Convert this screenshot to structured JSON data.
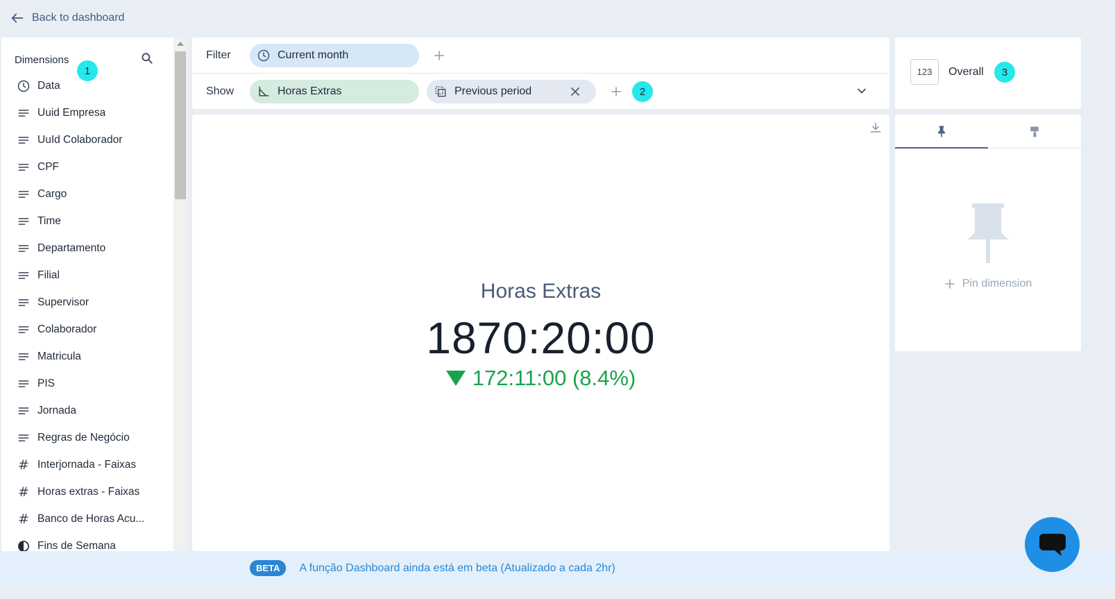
{
  "nav": {
    "back_label": "Back to dashboard"
  },
  "sidebar": {
    "title": "Dimensions",
    "badge": "1",
    "items": [
      {
        "label": "Data",
        "icon": "clock-icon"
      },
      {
        "label": "Uuid Empresa",
        "icon": "text-lines-icon"
      },
      {
        "label": "UuId Colaborador",
        "icon": "text-lines-icon"
      },
      {
        "label": "CPF",
        "icon": "text-lines-icon"
      },
      {
        "label": "Cargo",
        "icon": "text-lines-icon"
      },
      {
        "label": "Time",
        "icon": "text-lines-icon"
      },
      {
        "label": "Departamento",
        "icon": "text-lines-icon"
      },
      {
        "label": "Filial",
        "icon": "text-lines-icon"
      },
      {
        "label": "Supervisor",
        "icon": "text-lines-icon"
      },
      {
        "label": "Colaborador",
        "icon": "text-lines-icon"
      },
      {
        "label": "Matricula",
        "icon": "text-lines-icon"
      },
      {
        "label": "PIS",
        "icon": "text-lines-icon"
      },
      {
        "label": "Jornada",
        "icon": "text-lines-icon"
      },
      {
        "label": "Regras de Negócio",
        "icon": "text-lines-icon"
      },
      {
        "label": "Interjornada - Faixas",
        "icon": "hash-icon"
      },
      {
        "label": "Horas extras - Faixas",
        "icon": "hash-icon"
      },
      {
        "label": "Banco de Horas Acu...",
        "icon": "hash-icon"
      },
      {
        "label": "Fins de Semana",
        "icon": "half-circle-icon"
      }
    ]
  },
  "query": {
    "filter_label": "Filter",
    "filter_pill": "Current month",
    "show_label": "Show",
    "metric_pill": "Horas Extras",
    "compare_pill": "Previous period",
    "badge": "2"
  },
  "kpi": {
    "title": "Horas Extras",
    "value": "1870:20:00",
    "delta": "172:11:00 (8.4%)",
    "delta_direction": "down",
    "delta_color": "#1aa34a"
  },
  "viz": {
    "type_label": "123",
    "name": "Overall",
    "badge": "3"
  },
  "pin_panel": {
    "pin_dimension_label": "Pin dimension"
  },
  "footer": {
    "beta_label": "BETA",
    "message": "A função Dashboard ainda está em beta (Atualizado a cada 2hr)"
  },
  "colors": {
    "accent": "#2a86d3",
    "badge": "#24e8ea",
    "filter_pill": "#d6e7f8",
    "metric_pill": "#d5ebdf"
  }
}
